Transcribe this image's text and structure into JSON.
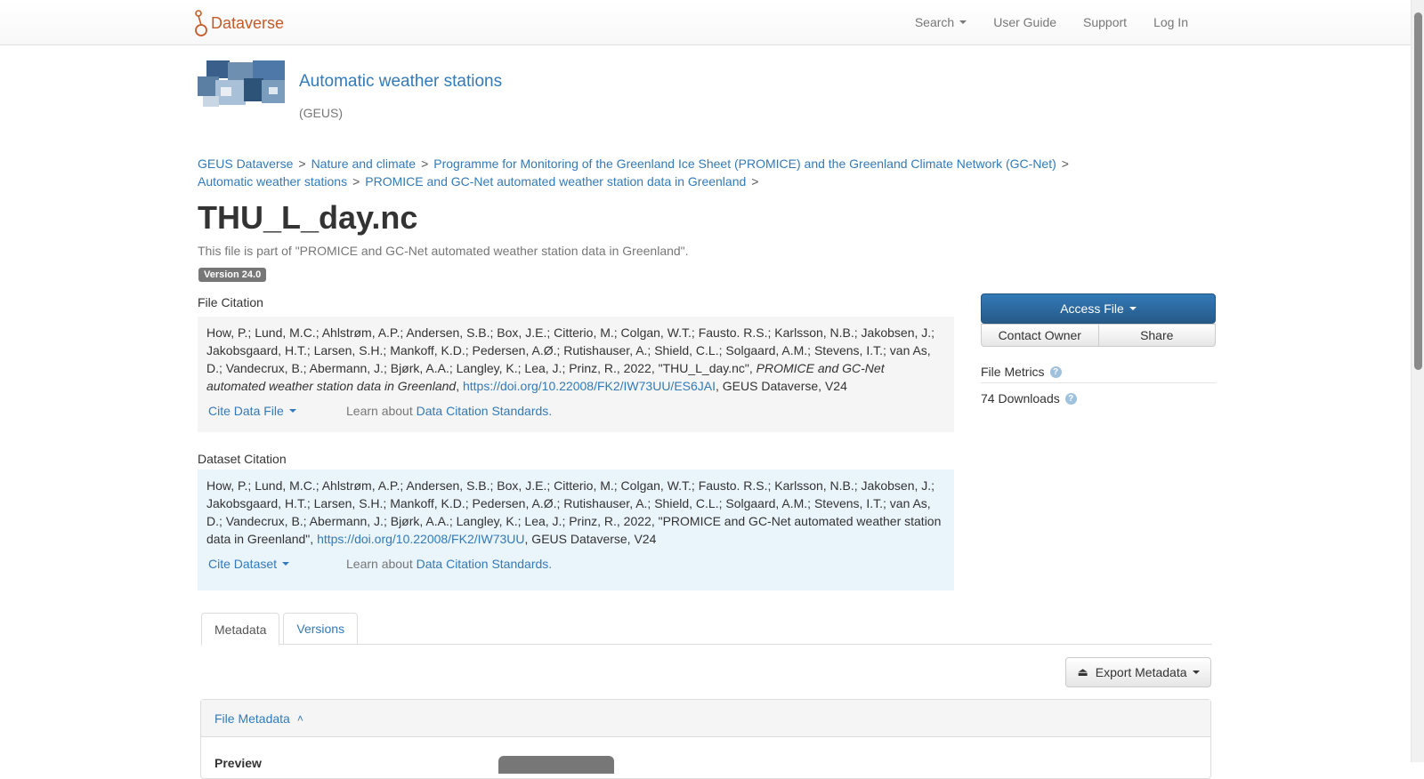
{
  "navbar": {
    "brand": "Dataverse",
    "items": [
      {
        "label": "Search",
        "dropdown": true
      },
      {
        "label": "User Guide",
        "dropdown": false
      },
      {
        "label": "Support",
        "dropdown": false
      },
      {
        "label": "Log In",
        "dropdown": false
      }
    ]
  },
  "dataverse": {
    "name": "Automatic weather stations",
    "affiliation": "(GEUS)"
  },
  "breadcrumb": [
    "GEUS Dataverse",
    "Nature and climate",
    "Programme for Monitoring of the Greenland Ice Sheet (PROMICE) and the Greenland Climate Network (GC-Net)",
    "Automatic weather stations",
    "PROMICE and GC-Net automated weather station data in Greenland"
  ],
  "file": {
    "title": "THU_L_day.nc",
    "part_of": "This file is part of \"PROMICE and GC-Net automated weather station data in Greenland\".",
    "version": "Version 24.0"
  },
  "file_citation": {
    "label": "File Citation",
    "text_before": "How, P.; Lund, M.C.; Ahlstrøm, A.P.; Andersen, S.B.; Box, J.E.; Citterio, M.; Colgan, W.T.; Fausto. R.S.; Karlsson, N.B.; Jakobsen, J.; Jakobsgaard, H.T.; Larsen, S.H.; Mankoff, K.D.; Pedersen, A.Ø.; Rutishauser, A.; Shield, C.L.; Solgaard, A.M.; Stevens, I.T.; van As, D.; Vandecrux, B.; Abermann, J.; Bjørk, A.A.; Langley, K.; Lea, J.; Prinz, R., 2022, \"THU_L_day.nc\", ",
    "italic": "PROMICE and GC-Net automated weather station data in Greenland",
    "sep": ", ",
    "doi": "https://doi.org/10.22008/FK2/IW73UU/ES6JAI",
    "text_after": ", GEUS Dataverse, V24",
    "cite_button": "Cite Data File",
    "learn_prefix": "Learn about ",
    "learn_link": "Data Citation Standards."
  },
  "dataset_citation": {
    "label": "Dataset Citation",
    "text_before": "How, P.; Lund, M.C.; Ahlstrøm, A.P.; Andersen, S.B.; Box, J.E.; Citterio, M.; Colgan, W.T.; Fausto. R.S.; Karlsson, N.B.; Jakobsen, J.; Jakobsgaard, H.T.; Larsen, S.H.; Mankoff, K.D.; Pedersen, A.Ø.; Rutishauser, A.; Shield, C.L.; Solgaard, A.M.; Stevens, I.T.; van As, D.; Vandecrux, B.; Abermann, J.; Bjørk, A.A.; Langley, K.; Lea, J.; Prinz, R., 2022, \"PROMICE and GC-Net automated weather station data in Greenland\", ",
    "doi": "https://doi.org/10.22008/FK2/IW73UU",
    "text_after": ", GEUS Dataverse, V24",
    "cite_button": "Cite Dataset",
    "learn_prefix": "Learn about ",
    "learn_link": "Data Citation Standards."
  },
  "actions": {
    "access_file": "Access File",
    "contact_owner": "Contact Owner",
    "share": "Share"
  },
  "metrics": {
    "title": "File Metrics",
    "downloads": "74 Downloads"
  },
  "tabs": [
    {
      "label": "Metadata",
      "active": true
    },
    {
      "label": "Versions",
      "active": false
    }
  ],
  "export_button": "Export Metadata",
  "file_metadata": {
    "heading": "File Metadata",
    "preview_label": "Preview"
  },
  "colors": {
    "brand": "#c55b28",
    "link": "#337ab7",
    "primary_button": "#337ab7"
  }
}
